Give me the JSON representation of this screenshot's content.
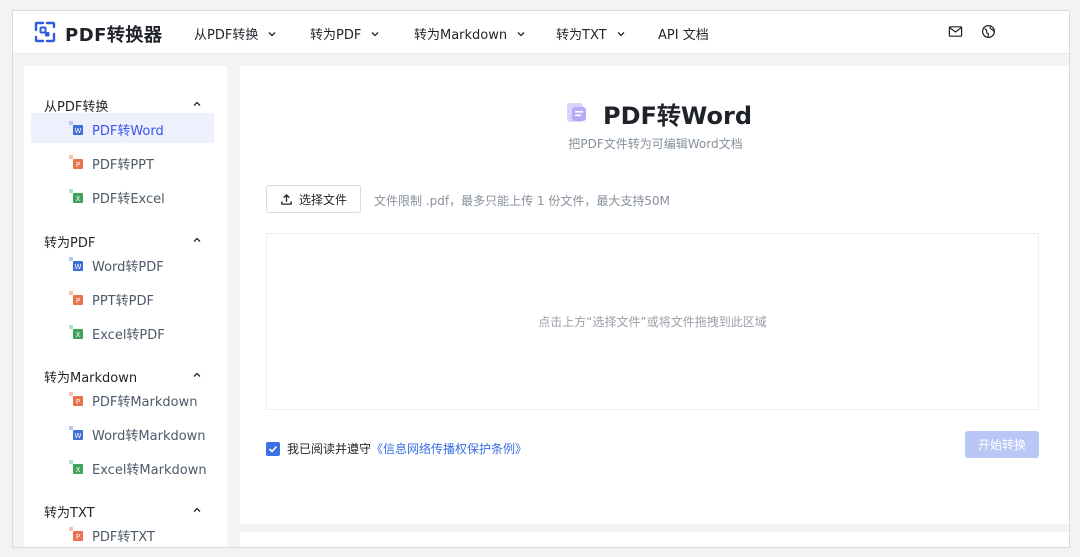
{
  "header": {
    "brand": "PDF转换器",
    "nav": [
      {
        "label": "从PDF转换",
        "has_dropdown": true
      },
      {
        "label": "转为PDF",
        "has_dropdown": true
      },
      {
        "label": "转为Markdown",
        "has_dropdown": true
      },
      {
        "label": "转为TXT",
        "has_dropdown": true
      },
      {
        "label": "API 文档",
        "has_dropdown": false
      }
    ],
    "icons": [
      "mail-icon",
      "globe-icon"
    ]
  },
  "sidebar": {
    "sections": [
      {
        "label": "从PDF转换",
        "expanded": true,
        "items": [
          {
            "label": "PDF转Word",
            "icon": "word",
            "active": true
          },
          {
            "label": "PDF转PPT",
            "icon": "ppt"
          },
          {
            "label": "PDF转Excel",
            "icon": "excel"
          }
        ]
      },
      {
        "label": "转为PDF",
        "expanded": true,
        "items": [
          {
            "label": "Word转PDF",
            "icon": "word"
          },
          {
            "label": "PPT转PDF",
            "icon": "ppt"
          },
          {
            "label": "Excel转PDF",
            "icon": "excel"
          }
        ]
      },
      {
        "label": "转为Markdown",
        "expanded": true,
        "items": [
          {
            "label": "PDF转Markdown",
            "icon": "ppt"
          },
          {
            "label": "Word转Markdown",
            "icon": "word"
          },
          {
            "label": "Excel转Markdown",
            "icon": "excel"
          }
        ]
      },
      {
        "label": "转为TXT",
        "expanded": true,
        "items": [
          {
            "label": "PDF转TXT",
            "icon": "ppt"
          }
        ]
      }
    ]
  },
  "main": {
    "title": "PDF转Word",
    "subtitle": "把PDF文件转为可编辑Word文档",
    "select_button": "选择文件",
    "limit_text": "文件限制 .pdf，最多只能上传 1 份文件，最大支持50M",
    "dropzone_text": "点击上方“选择文件”或将文件拖拽到此区域",
    "agree_text": "我已阅读并遵守",
    "agree_link": "《信息网络传播权保护条例》",
    "agree_checked": true,
    "start_button": "开始转换"
  },
  "colors": {
    "accent": "#3a6fe6",
    "active_bg": "#eef0fe",
    "start_disabled": "#b9c7f7",
    "word": "#3d6fd6",
    "ppt": "#e8734d",
    "excel": "#3ea35b"
  }
}
